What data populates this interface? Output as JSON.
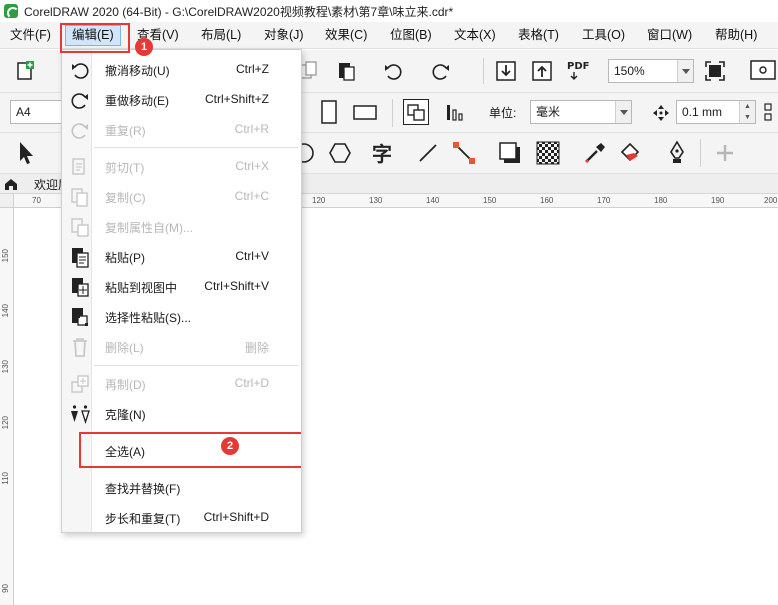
{
  "window": {
    "title": "CorelDRAW 2020 (64-Bit) - G:\\CorelDRAW2020视频教程\\素材\\第7章\\味立来.cdr*"
  },
  "menubar": {
    "items": [
      "文件(F)",
      "编辑(E)",
      "查看(V)",
      "布局(L)",
      "对象(J)",
      "效果(C)",
      "位图(B)",
      "文本(X)",
      "表格(T)",
      "工具(O)",
      "窗口(W)",
      "帮助(H)"
    ],
    "active_index": 1
  },
  "toolbar": {
    "zoom_value": "150%"
  },
  "property_bar": {
    "page_size": "A4",
    "unit_label": "单位:",
    "unit_value": "毫米",
    "nudge_value": "0.1 mm"
  },
  "document_tab": {
    "label": "欢迎屏"
  },
  "ruler": {
    "h_ticks": [
      "70",
      "120",
      "130",
      "140",
      "150",
      "160",
      "170",
      "180",
      "190",
      "200"
    ],
    "v_ticks": [
      "150",
      "140",
      "130",
      "120",
      "110",
      "90"
    ]
  },
  "edit_menu": {
    "items": [
      {
        "label": "撤消移动(U)",
        "shortcut": "Ctrl+Z",
        "enabled": true
      },
      {
        "label": "重做移动(E)",
        "shortcut": "Ctrl+Shift+Z",
        "enabled": true
      },
      {
        "label": "重复(R)",
        "shortcut": "Ctrl+R",
        "enabled": false
      },
      {
        "label": "剪切(T)",
        "shortcut": "Ctrl+X",
        "enabled": false
      },
      {
        "label": "复制(C)",
        "shortcut": "Ctrl+C",
        "enabled": false
      },
      {
        "label": "复制属性自(M)...",
        "shortcut": "",
        "enabled": false
      },
      {
        "label": "粘贴(P)",
        "shortcut": "Ctrl+V",
        "enabled": true
      },
      {
        "label": "粘贴到视图中",
        "shortcut": "Ctrl+Shift+V",
        "enabled": true
      },
      {
        "label": "选择性粘贴(S)...",
        "shortcut": "",
        "enabled": true
      },
      {
        "label": "删除(L)",
        "shortcut": "删除",
        "enabled": false
      },
      {
        "label": "再制(D)",
        "shortcut": "Ctrl+D",
        "enabled": false
      },
      {
        "label": "克隆(N)",
        "shortcut": "",
        "enabled": true
      },
      {
        "label": "全选(A)",
        "shortcut": "",
        "enabled": true
      },
      {
        "label": "查找并替换(F)",
        "shortcut": "",
        "enabled": true
      },
      {
        "label": "步长和重复(T)",
        "shortcut": "Ctrl+Shift+D",
        "enabled": true
      }
    ]
  },
  "annotations": {
    "step1": "1",
    "step2": "2",
    "highlight_color": "#e53935"
  },
  "icons": [
    "new-document-icon",
    "undo-icon",
    "redo-icon",
    "import-icon",
    "export-icon",
    "pdf-icon",
    "full-screen-icon",
    "pointer-tool-icon",
    "text-tool-icon",
    "eyedropper-icon",
    "fill-icon",
    "pen-tool-icon",
    "plus-icon"
  ]
}
